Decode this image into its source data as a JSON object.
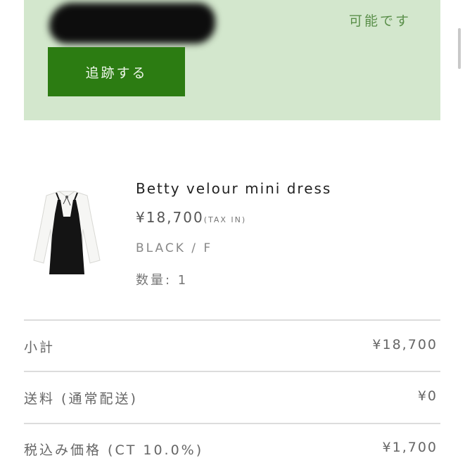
{
  "tracking": {
    "status_text": "可能です",
    "button_label": "追跡する"
  },
  "product": {
    "name": "Betty velour mini dress",
    "price": "¥18,700",
    "tax_note": "(TAX IN)",
    "variant": "BLACK / F",
    "quantity": "数量: 1"
  },
  "summary": {
    "rows": [
      {
        "label": "小計",
        "value": "¥18,700"
      },
      {
        "label": "送料 (通常配送)",
        "value": "¥0"
      },
      {
        "label": "税込み価格 (CT 10.0%)",
        "value": "¥1,700"
      }
    ]
  },
  "colors": {
    "banner_bg": "#d3e7cd",
    "button_bg": "#2c7c12",
    "status_text": "#5a8f4a"
  }
}
